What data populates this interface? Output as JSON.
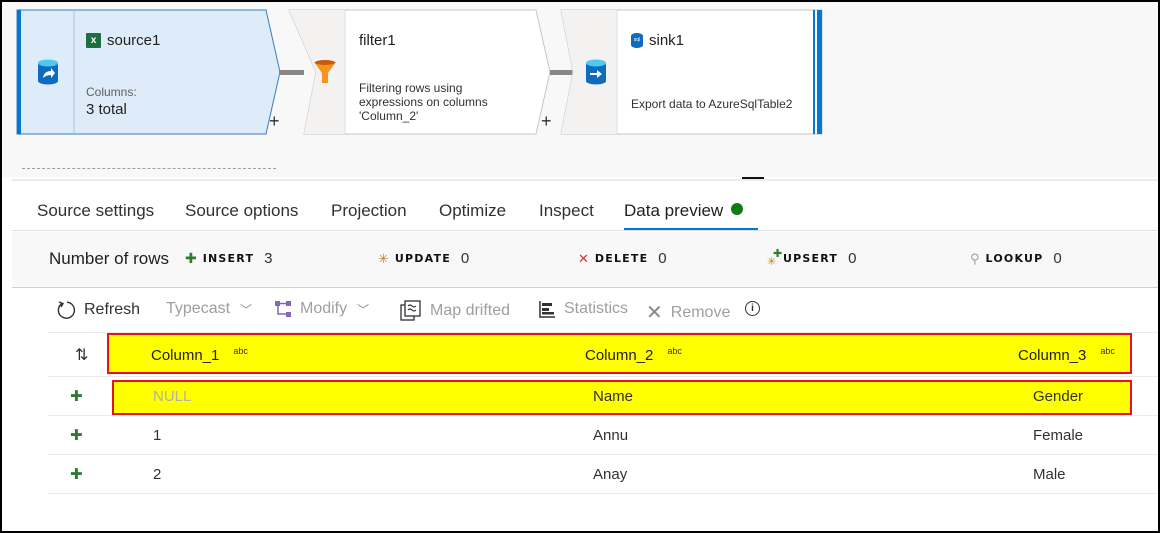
{
  "canvas": {
    "nodes": [
      {
        "id": "source1",
        "title": "source1",
        "title_icon": "excel-icon",
        "main_icon": "source-database-icon",
        "sub_label": "Columns:",
        "sub_value": "3 total",
        "selected": true
      },
      {
        "id": "filter1",
        "title": "filter1",
        "main_icon": "filter-funnel-icon",
        "description": "Filtering rows using expressions on columns 'Column_2'"
      },
      {
        "id": "sink1",
        "title": "sink1",
        "title_icon": "sql-database-icon",
        "main_icon": "sink-database-icon",
        "description": "Export data to AzureSqlTable2"
      }
    ],
    "add_symbol": "+"
  },
  "tabs": {
    "items": [
      {
        "label": "Source settings"
      },
      {
        "label": "Source options"
      },
      {
        "label": "Projection"
      },
      {
        "label": "Optimize"
      },
      {
        "label": "Inspect"
      },
      {
        "label": "Data preview",
        "active": true,
        "status": "green-dot"
      }
    ]
  },
  "counts": {
    "label": "Number of rows",
    "items": [
      {
        "icon": "insert-plus-icon",
        "label": "INSERT",
        "value": "3"
      },
      {
        "icon": "update-asterisk-icon",
        "label": "UPDATE",
        "value": "0"
      },
      {
        "icon": "delete-x-icon",
        "label": "DELETE",
        "value": "0"
      },
      {
        "icon": "upsert-icon",
        "label": "UPSERT",
        "value": "0"
      },
      {
        "icon": "lookup-search-icon",
        "label": "LOOKUP",
        "value": "0"
      }
    ]
  },
  "toolbar": {
    "refresh": "Refresh",
    "typecast": "Typecast",
    "modify": "Modify",
    "map_drifted": "Map drifted",
    "statistics": "Statistics",
    "remove": "Remove"
  },
  "grid": {
    "columns": [
      {
        "name": "Column_1",
        "type": "abc"
      },
      {
        "name": "Column_2",
        "type": "abc"
      },
      {
        "name": "Column_3",
        "type": "abc"
      }
    ],
    "rows": [
      {
        "marker": "+",
        "cells": [
          "NULL",
          "Name",
          "Gender"
        ],
        "highlighted": true
      },
      {
        "marker": "+",
        "cells": [
          "1",
          "Annu",
          "Female"
        ]
      },
      {
        "marker": "+",
        "cells": [
          "2",
          "Anay",
          "Male"
        ]
      }
    ]
  },
  "colors": {
    "accent": "#0078d4",
    "selected_node_bg": "#deecf9",
    "highlight_fill": "#ffff00",
    "highlight_border": "#e81123",
    "insert_green": "#2e7d32",
    "status_green": "#107c10"
  }
}
